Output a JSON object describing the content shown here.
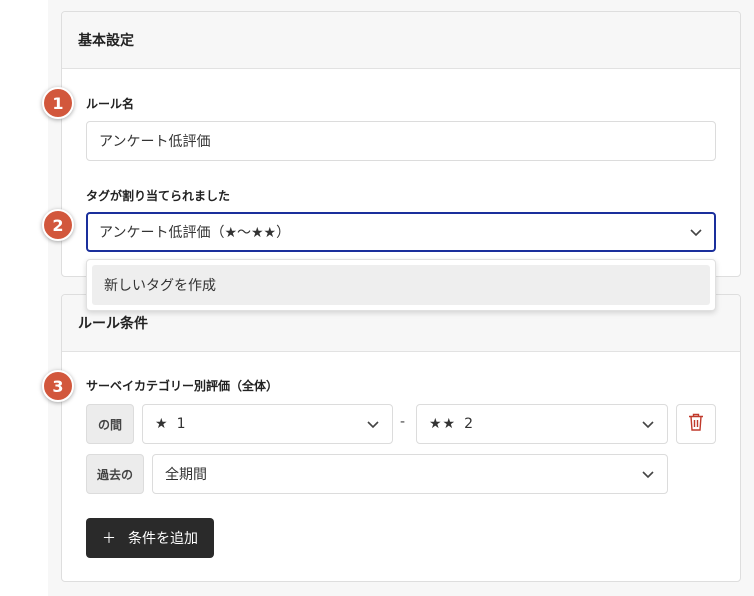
{
  "basic_settings": {
    "title": "基本設定",
    "rule_name_label": "ルール名",
    "rule_name_value": "アンケート低評価",
    "tag_label": "タグが割り当てられました",
    "tag_value": "アンケート低評価（★〜★★）",
    "dropdown_option": "新しいタグを作成"
  },
  "rule_conditions": {
    "title": "ルール条件",
    "condition_label": "サーベイカテゴリー別評価（全体）",
    "between_label": "の間",
    "from_stars": "★",
    "from_value": "1",
    "separator": "-",
    "to_stars": "★★",
    "to_value": "2",
    "period_label": "過去の",
    "period_value": "全期間",
    "add_button_plus": "＋",
    "add_button_label": "条件を追加"
  },
  "steps": [
    "1",
    "2",
    "3"
  ],
  "colors": {
    "badge": "#d2573c",
    "focus_border": "#1a2f9c",
    "delete_icon": "#c0392b",
    "add_button_bg": "#2a2a2a"
  },
  "icons": {
    "dropdown": "chevron-down-icon",
    "delete": "trash-icon",
    "add": "plus-icon"
  }
}
